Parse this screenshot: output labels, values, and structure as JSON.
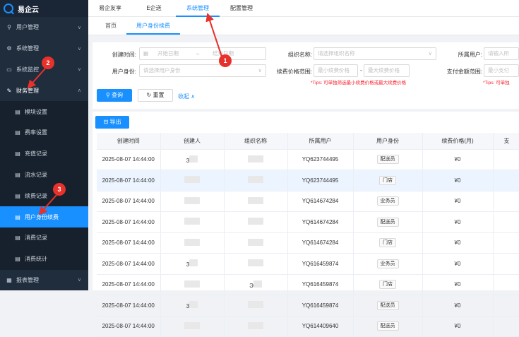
{
  "app": {
    "title": "易企云"
  },
  "sidebar": {
    "items": [
      {
        "label": "用户管理",
        "icon": "user-icon",
        "chev": "∨"
      },
      {
        "label": "系统管理",
        "icon": "gear-icon",
        "chev": "∨"
      },
      {
        "label": "系统监控",
        "icon": "monitor-icon",
        "chev": "∨"
      },
      {
        "label": "财务管理",
        "icon": "wrench-icon",
        "chev": "∧"
      },
      {
        "label": "模块设置",
        "icon": "doc-icon"
      },
      {
        "label": "费率设置",
        "icon": "doc-icon"
      },
      {
        "label": "充值记录",
        "icon": "doc-icon"
      },
      {
        "label": "流水记录",
        "icon": "doc-icon"
      },
      {
        "label": "续费记录",
        "icon": "doc-icon"
      },
      {
        "label": "用户身份续费",
        "icon": "doc-icon"
      },
      {
        "label": "消费记录",
        "icon": "doc-icon"
      },
      {
        "label": "消费统计",
        "icon": "doc-icon"
      },
      {
        "label": "报表管理",
        "icon": "chart-icon",
        "chev": "∨"
      }
    ]
  },
  "topnav": {
    "items": [
      "易企友享",
      "E企送",
      "系统管理",
      "配置管理"
    ]
  },
  "tabs": [
    "首页",
    "用户身份续费"
  ],
  "filters": {
    "created_label": "创建时间:",
    "start_placeholder": "开始日期",
    "range_sep": "–",
    "end_placeholder": "结束日期",
    "org_label": "组织名称:",
    "org_placeholder": "请选择组织名称",
    "owner_label": "所属用户:",
    "owner_placeholder": "请输入所",
    "identity_label": "用户身份:",
    "identity_placeholder": "请选择用户身份",
    "price_label": "续费价格范围:",
    "price_min": "最小续费价格",
    "price_sep": "-",
    "price_max": "最大续费价格",
    "price_tips": "*Tips: 可单独筛选最小续费价格或最大续费价格",
    "amount_label": "支付金额范围:",
    "amount_min": "最小支付",
    "amount_tips": "*Tips: 可单独",
    "search_btn": "查询",
    "reset_btn": "重置",
    "collapse_link": "收起"
  },
  "toolbar": {
    "export_btn": "导出"
  },
  "table": {
    "columns": [
      "创建时间",
      "创建人",
      "组织名称",
      "所属用户",
      "用户身份",
      "续费价格(月)",
      "支"
    ],
    "rows": [
      {
        "time": "2025-08-07 14:44:00",
        "user": "YQ623744495",
        "role": "配送员",
        "price": "¥0"
      },
      {
        "time": "2025-08-07 14:44:00",
        "user": "YQ623744495",
        "role": "门店",
        "price": "¥0"
      },
      {
        "time": "2025-08-07 14:44:00",
        "user": "YQ614674284",
        "role": "业务员",
        "price": "¥0"
      },
      {
        "time": "2025-08-07 14:44:00",
        "user": "YQ614674284",
        "role": "配送员",
        "price": "¥0"
      },
      {
        "time": "2025-08-07 14:44:00",
        "user": "YQ614674284",
        "role": "门店",
        "price": "¥0"
      },
      {
        "time": "2025-08-07 14:44:00",
        "user": "YQ616459874",
        "role": "业务员",
        "price": "¥0"
      },
      {
        "time": "2025-08-07 14:44:00",
        "user": "YQ616459874",
        "role": "门店",
        "price": "¥0"
      },
      {
        "time": "2025-08-07 14:44:00",
        "user": "YQ616459874",
        "role": "配送员",
        "price": "¥0"
      },
      {
        "time": "2025-08-07 14:44:00",
        "user": "YQ614409640",
        "role": "配送员",
        "price": "¥0"
      }
    ],
    "creator_fragments": [
      "3",
      "3",
      "Э",
      "3"
    ]
  },
  "annotations": [
    "1",
    "2",
    "3"
  ],
  "colors": {
    "accent": "#1890ff",
    "sidebar_bg": "#1f2d3d",
    "annotation": "#e8312a"
  }
}
